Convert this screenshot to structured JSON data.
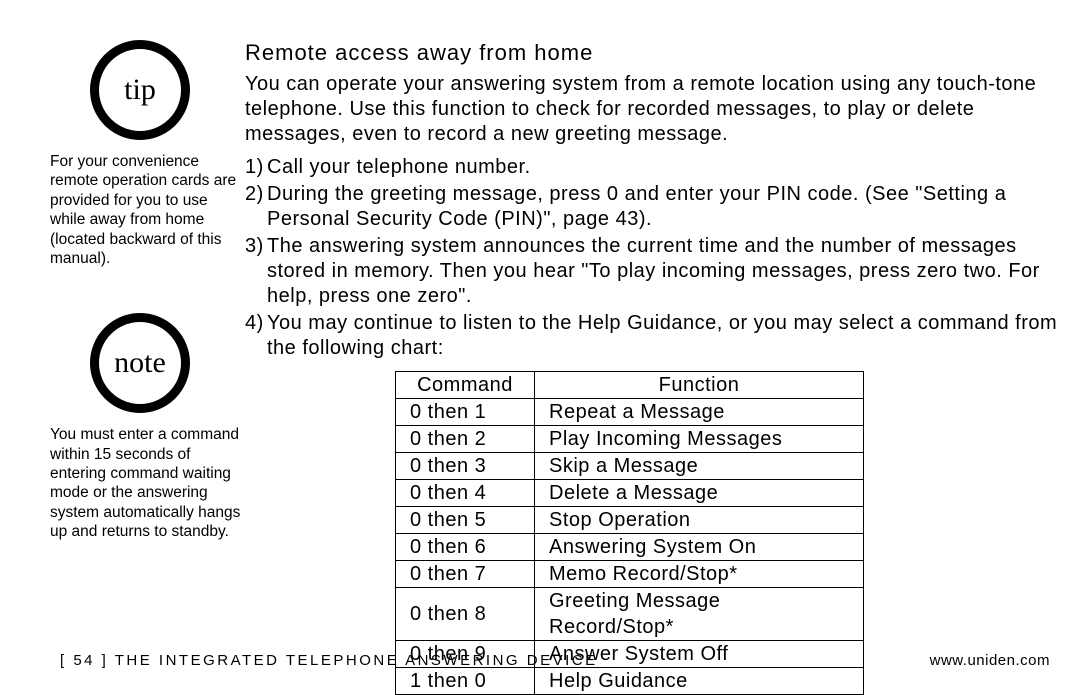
{
  "sidebar": {
    "tip_label": "tip",
    "tip_text": "For your convenience remote operation cards are provided for you to use while away from home (located backward of this manual).",
    "note_label": "note",
    "note_text": "You must enter a command within 15 seconds of entering command waiting mode or the answering system automatically hangs up and returns to standby."
  },
  "main": {
    "heading": "Remote access away from home",
    "intro": "You can operate your answering system from a remote location using any touch-tone telephone. Use this function to check for recorded messages, to play or delete messages, even to record a new greeting message.",
    "steps": [
      {
        "n": "1)",
        "text": "Call your telephone number."
      },
      {
        "n": "2)",
        "text": "During the greeting message, press 0 and enter your PIN code.\n(See \"Setting a Personal Security Code (PIN)\", page 43)."
      },
      {
        "n": "3)",
        "text": "The answering system announces the current time and the number of messages stored in memory. Then you hear \"To play incoming messages, press zero two. For help, press one zero\"."
      },
      {
        "n": "4)",
        "text": "You may continue to listen to the Help Guidance, or you may select a command from the following chart:"
      }
    ],
    "table": {
      "header": {
        "command": "Command",
        "function": "Function"
      },
      "rows": [
        {
          "command": "0 then 1",
          "function": "Repeat a Message"
        },
        {
          "command": "0 then 2",
          "function": "Play Incoming Messages"
        },
        {
          "command": "0 then 3",
          "function": "Skip a Message"
        },
        {
          "command": "0 then 4",
          "function": "Delete a Message"
        },
        {
          "command": "0 then 5",
          "function": "Stop Operation"
        },
        {
          "command": "0 then 6",
          "function": "Answering System On"
        },
        {
          "command": "0 then 7",
          "function": "Memo Record/Stop*"
        },
        {
          "command": "0 then 8",
          "function": "Greeting Message Record/Stop*"
        },
        {
          "command": "0 then 9",
          "function": "Answer System Off"
        },
        {
          "command": "1 then 0",
          "function": "Help Guidance"
        }
      ]
    }
  },
  "footer": {
    "left": "[ 54 ]   THE INTEGRATED TELEPHONE ANSWERING DEVICE",
    "right": "www.uniden.com"
  }
}
